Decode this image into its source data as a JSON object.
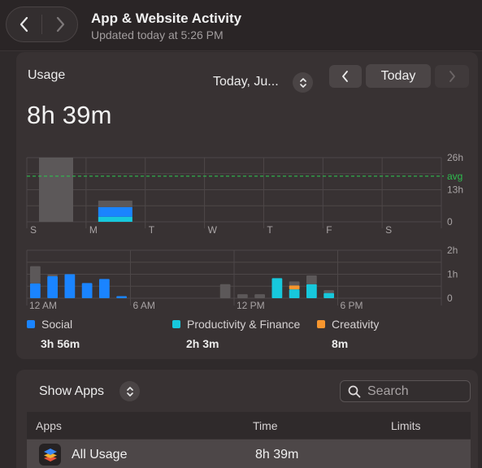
{
  "header": {
    "title": "App & Website Activity",
    "subtitle": "Updated today at 5:26 PM"
  },
  "usage": {
    "label": "Usage",
    "total": "8h 39m",
    "date_select": "Today, Ju...",
    "today_button": "Today"
  },
  "chart_data": [
    {
      "type": "bar",
      "name": "weekly",
      "categories": [
        "S",
        "M",
        "T",
        "W",
        "T",
        "F",
        "S"
      ],
      "series": [
        {
          "name": "Other",
          "values": [
            26,
            2.6,
            0,
            0,
            0,
            0,
            0
          ]
        },
        {
          "name": "Social",
          "values": [
            0,
            3.93,
            0,
            0,
            0,
            0,
            0
          ]
        },
        {
          "name": "Productivity & Finance",
          "values": [
            0,
            2.05,
            0,
            0,
            0,
            0,
            0
          ]
        }
      ],
      "stacked": true,
      "y_ticks": [
        "26h",
        "13h",
        "0"
      ],
      "ylim": [
        0,
        26
      ],
      "avg_label": "avg",
      "avg_value": 18.5,
      "grid": true
    },
    {
      "type": "bar",
      "name": "hourly",
      "x_ticks": [
        "12 AM",
        "6 AM",
        "12 PM",
        "6 PM"
      ],
      "y_ticks": [
        "2h",
        "1h",
        "0"
      ],
      "ylim": [
        0,
        120
      ],
      "stacked": true,
      "bars": [
        {
          "hour": 0,
          "social": 37,
          "productivity": 0,
          "creativity": 0,
          "other": 43
        },
        {
          "hour": 1,
          "social": 55,
          "productivity": 0,
          "creativity": 0,
          "other": 4
        },
        {
          "hour": 2,
          "social": 60,
          "productivity": 0,
          "creativity": 0,
          "other": 0
        },
        {
          "hour": 3,
          "social": 38,
          "productivity": 0,
          "creativity": 0,
          "other": 0
        },
        {
          "hour": 4,
          "social": 48,
          "productivity": 0,
          "creativity": 0,
          "other": 0
        },
        {
          "hour": 5,
          "social": 5,
          "productivity": 0,
          "creativity": 0,
          "other": 0
        },
        {
          "hour": 11,
          "social": 0,
          "productivity": 0,
          "creativity": 0,
          "other": 35
        },
        {
          "hour": 12,
          "social": 0,
          "productivity": 0,
          "creativity": 0,
          "other": 10
        },
        {
          "hour": 13,
          "social": 0,
          "productivity": 0,
          "creativity": 0,
          "other": 10
        },
        {
          "hour": 14,
          "social": 0,
          "productivity": 50,
          "creativity": 0,
          "other": 0
        },
        {
          "hour": 15,
          "social": 0,
          "productivity": 22,
          "creativity": 10,
          "other": 10
        },
        {
          "hour": 16,
          "social": 0,
          "productivity": 35,
          "creativity": 0,
          "other": 22
        },
        {
          "hour": 17,
          "social": 0,
          "productivity": 13,
          "creativity": 0,
          "other": 7
        }
      ],
      "grid": true
    }
  ],
  "legend": [
    {
      "label": "Social",
      "value": "3h 56m",
      "color": "#1a84ff"
    },
    {
      "label": "Productivity & Finance",
      "value": "2h 3m",
      "color": "#17c8dc"
    },
    {
      "label": "Creativity",
      "value": "8m",
      "color": "#f7962e"
    }
  ],
  "colors": {
    "other": "#5c5859",
    "avg": "#2ebd4f",
    "social": "#1a84ff",
    "productivity": "#17c8dc",
    "creativity": "#f7962e"
  },
  "apps": {
    "show_apps": "Show Apps",
    "search_placeholder": "Search",
    "columns": {
      "apps": "Apps",
      "time": "Time",
      "limits": "Limits"
    },
    "rows": [
      {
        "name": "All Usage",
        "time": "8h 39m"
      }
    ]
  },
  "icons": {
    "back": "chevron-left-icon",
    "forward": "chevron-right-icon",
    "stepper": "chevron-up-down-icon",
    "search": "magnifier-icon",
    "stack": "layers-icon"
  }
}
